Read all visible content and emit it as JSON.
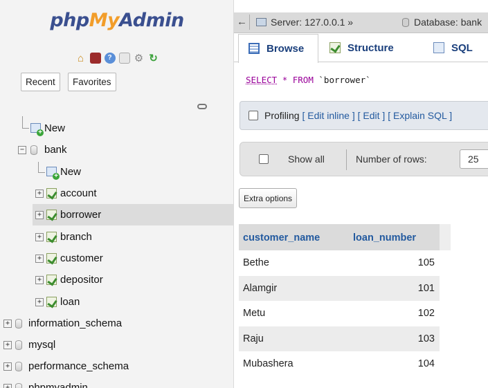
{
  "sidebar": {
    "logo": {
      "php": "php",
      "my": "My",
      "admin": "Admin"
    },
    "icons": [
      "home-icon",
      "exit-icon",
      "help-icon",
      "docs-icon",
      "settings-icon",
      "reload-icon"
    ],
    "buttons": {
      "recent": "Recent",
      "favorites": "Favorites"
    },
    "tree": {
      "new_top": "New",
      "bank": "bank",
      "bank_new": "New",
      "tables": [
        "account",
        "borrower",
        "branch",
        "customer",
        "depositor",
        "loan"
      ],
      "selected_table": "borrower",
      "databases": [
        "information_schema",
        "mysql",
        "performance_schema",
        "phpmyadmin"
      ]
    }
  },
  "breadcrumb": {
    "server": "Server: 127.0.0.1",
    "separator": "»",
    "database": "Database: bank"
  },
  "tabs": [
    "Browse",
    "Structure",
    "SQL"
  ],
  "active_tab": "Browse",
  "query": {
    "select": "SELECT",
    "star": "*",
    "from": "FROM",
    "table": "`borrower`"
  },
  "profiling": {
    "label": "Profiling",
    "edit_inline": "[ Edit inline ]",
    "edit": "[ Edit ]",
    "explain": "[ Explain SQL ]"
  },
  "navigation": {
    "show_all": "Show all",
    "number_of_rows_label": "Number of rows:",
    "number_of_rows_value": "25"
  },
  "extra_options": "Extra options",
  "results": {
    "columns": [
      "customer_name",
      "loan_number"
    ],
    "rows": [
      [
        "Bethe",
        "105"
      ],
      [
        "Alamgir",
        "101"
      ],
      [
        "Metu",
        "102"
      ],
      [
        "Raju",
        "103"
      ],
      [
        "Mubashera",
        "104"
      ]
    ]
  },
  "colors": {
    "link": "#235a9f",
    "logo_blue": "#3a4f8f",
    "logo_orange": "#f29d2a",
    "keyword": "#990099"
  }
}
